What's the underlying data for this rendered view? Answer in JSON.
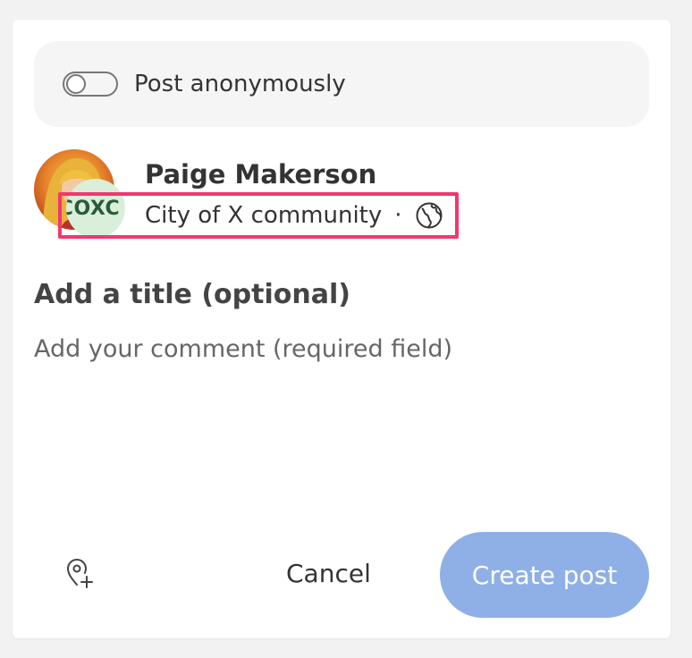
{
  "anonymous": {
    "label": "Post anonymously",
    "enabled": false
  },
  "author": {
    "name": "Paige Makerson",
    "community_badge": "COXC",
    "community": "City of X community",
    "separator": "·",
    "visibility_icon": "globe-icon"
  },
  "form": {
    "title_placeholder": "Add a title (optional)",
    "comment_placeholder": "Add your comment (required field)"
  },
  "actions": {
    "location_icon": "add-location-icon",
    "cancel_label": "Cancel",
    "create_label": "Create post"
  },
  "colors": {
    "create_button": "#8eb0e6",
    "highlight": "#f0386f",
    "community_badge_bg": "#d9efd9"
  }
}
